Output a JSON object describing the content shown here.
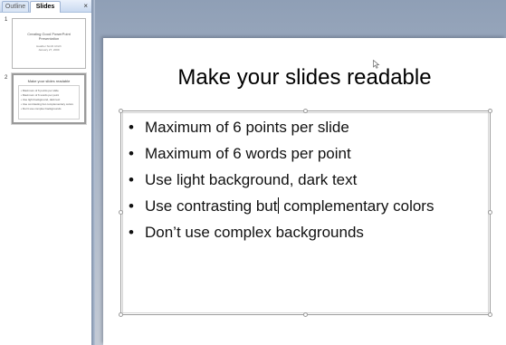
{
  "left_pane": {
    "tabs": [
      {
        "label": "Outline",
        "active": false
      },
      {
        "label": "Slides",
        "active": true
      }
    ],
    "close_glyph": "×",
    "thumbnails": [
      {
        "number": "1",
        "title_line1": "Creating Good PowerPoint",
        "title_line2": "Presentation",
        "sub_line1": "Heather Smith Ulrich",
        "sub_line2": "January 27, 2009"
      },
      {
        "number": "2",
        "title": "Make your slides readable",
        "bullets": [
          "Maximum of 6 points per slide",
          "Maximum of 6 words per point",
          "Use light background, dark text",
          "Use contrasting but complementary colors",
          "Don't use complex backgrounds"
        ]
      }
    ]
  },
  "slide": {
    "title": "Make your slides readable",
    "bullet_glyph": "•",
    "bullets": [
      "Maximum of 6 points per slide",
      "Maximum of 6 words per point",
      "Use light background, dark text",
      "Use contrasting but complementary colors",
      "Don’t use complex backgrounds"
    ],
    "caret_line": {
      "before": "Use contrasting but",
      "after": " complementary colors"
    }
  },
  "colors": {
    "workspace": "#a9b5c6",
    "tab_strip": "#c9d9f0",
    "slide_background": "#ffffff",
    "text": "#111111"
  },
  "icons": {
    "mouse_pointer": "arrow-cursor-icon"
  }
}
